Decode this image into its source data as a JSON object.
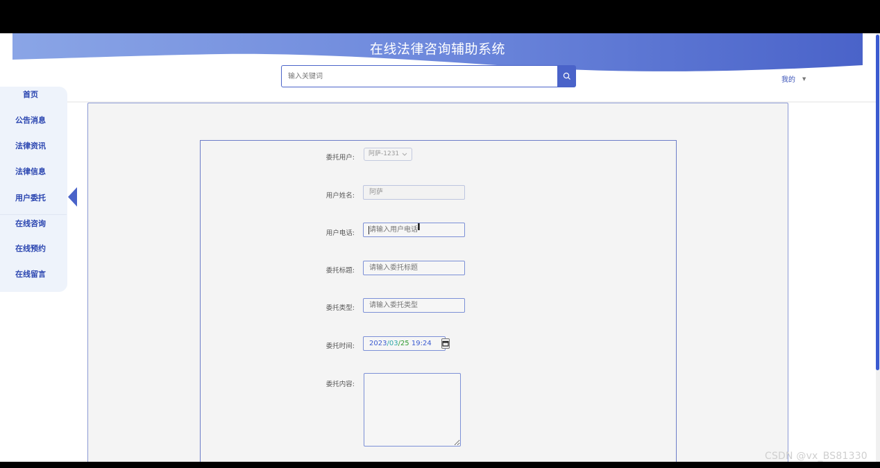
{
  "header": {
    "title": "在线法律咨询辅助系统",
    "search_placeholder": "输入关键词",
    "user_menu_label": "我的",
    "brand_color": "#4a63c9"
  },
  "sidebar": {
    "items": [
      {
        "label": "首页"
      },
      {
        "label": "公告消息"
      },
      {
        "label": "法律资讯"
      },
      {
        "label": "法律信息"
      },
      {
        "label": "用户委托"
      },
      {
        "label": "在线咨询"
      },
      {
        "label": "在线预约"
      },
      {
        "label": "在线留言"
      }
    ],
    "active_index": 4
  },
  "form": {
    "client_user": {
      "label": "委托用户:",
      "value": "阿萨-1231"
    },
    "user_name": {
      "label": "用户姓名:",
      "value": "阿萨"
    },
    "user_phone": {
      "label": "用户电话:",
      "placeholder": "请输入用户电话"
    },
    "title": {
      "label": "委托标题:",
      "placeholder": "请输入委托标题"
    },
    "type": {
      "label": "委托类型:",
      "placeholder": "请输入委托类型"
    },
    "time": {
      "label": "委托时间:",
      "year": "2023",
      "month": "03",
      "day": "25",
      "clock": "19:24"
    },
    "content": {
      "label": "委托内容:"
    }
  },
  "watermark": "CSDN @vx_BS81330"
}
